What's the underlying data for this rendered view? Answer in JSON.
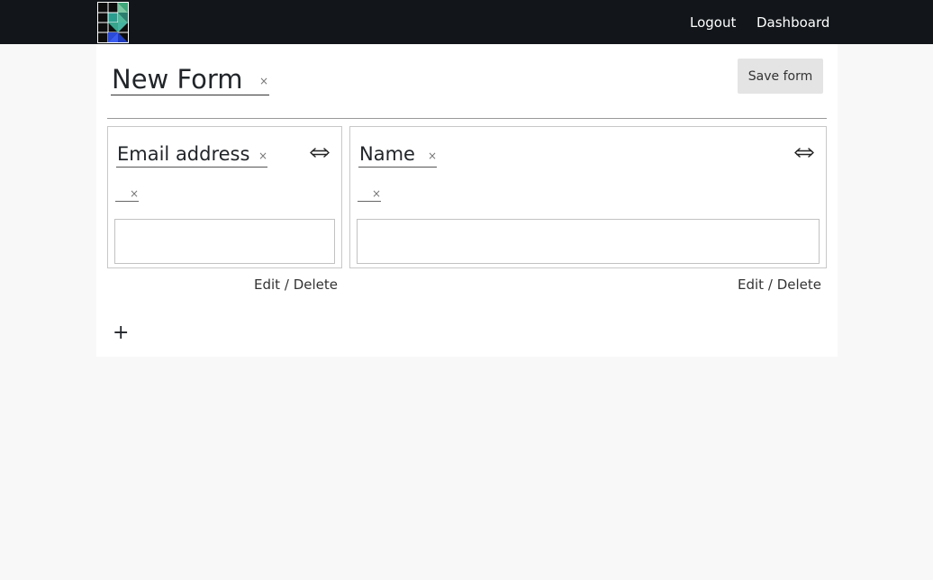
{
  "nav": {
    "logo": "logo-icon",
    "links": [
      {
        "label": "Logout"
      },
      {
        "label": "Dashboard"
      }
    ],
    "colors": {
      "background": "#12161a",
      "text": "#ffffff"
    }
  },
  "form": {
    "title": "New Form",
    "clear_icon": "×",
    "save_label": "Save form",
    "add_label": "+"
  },
  "fields": [
    {
      "label": "Email address",
      "sub_label": "",
      "resize_icon": "horizontal-resize-icon",
      "value": "",
      "edit_label": "Edit",
      "separator": "/",
      "delete_label": "Delete"
    },
    {
      "label": "Name",
      "sub_label": "",
      "resize_icon": "horizontal-resize-icon",
      "value": "",
      "edit_label": "Edit",
      "separator": "/",
      "delete_label": "Delete"
    }
  ]
}
